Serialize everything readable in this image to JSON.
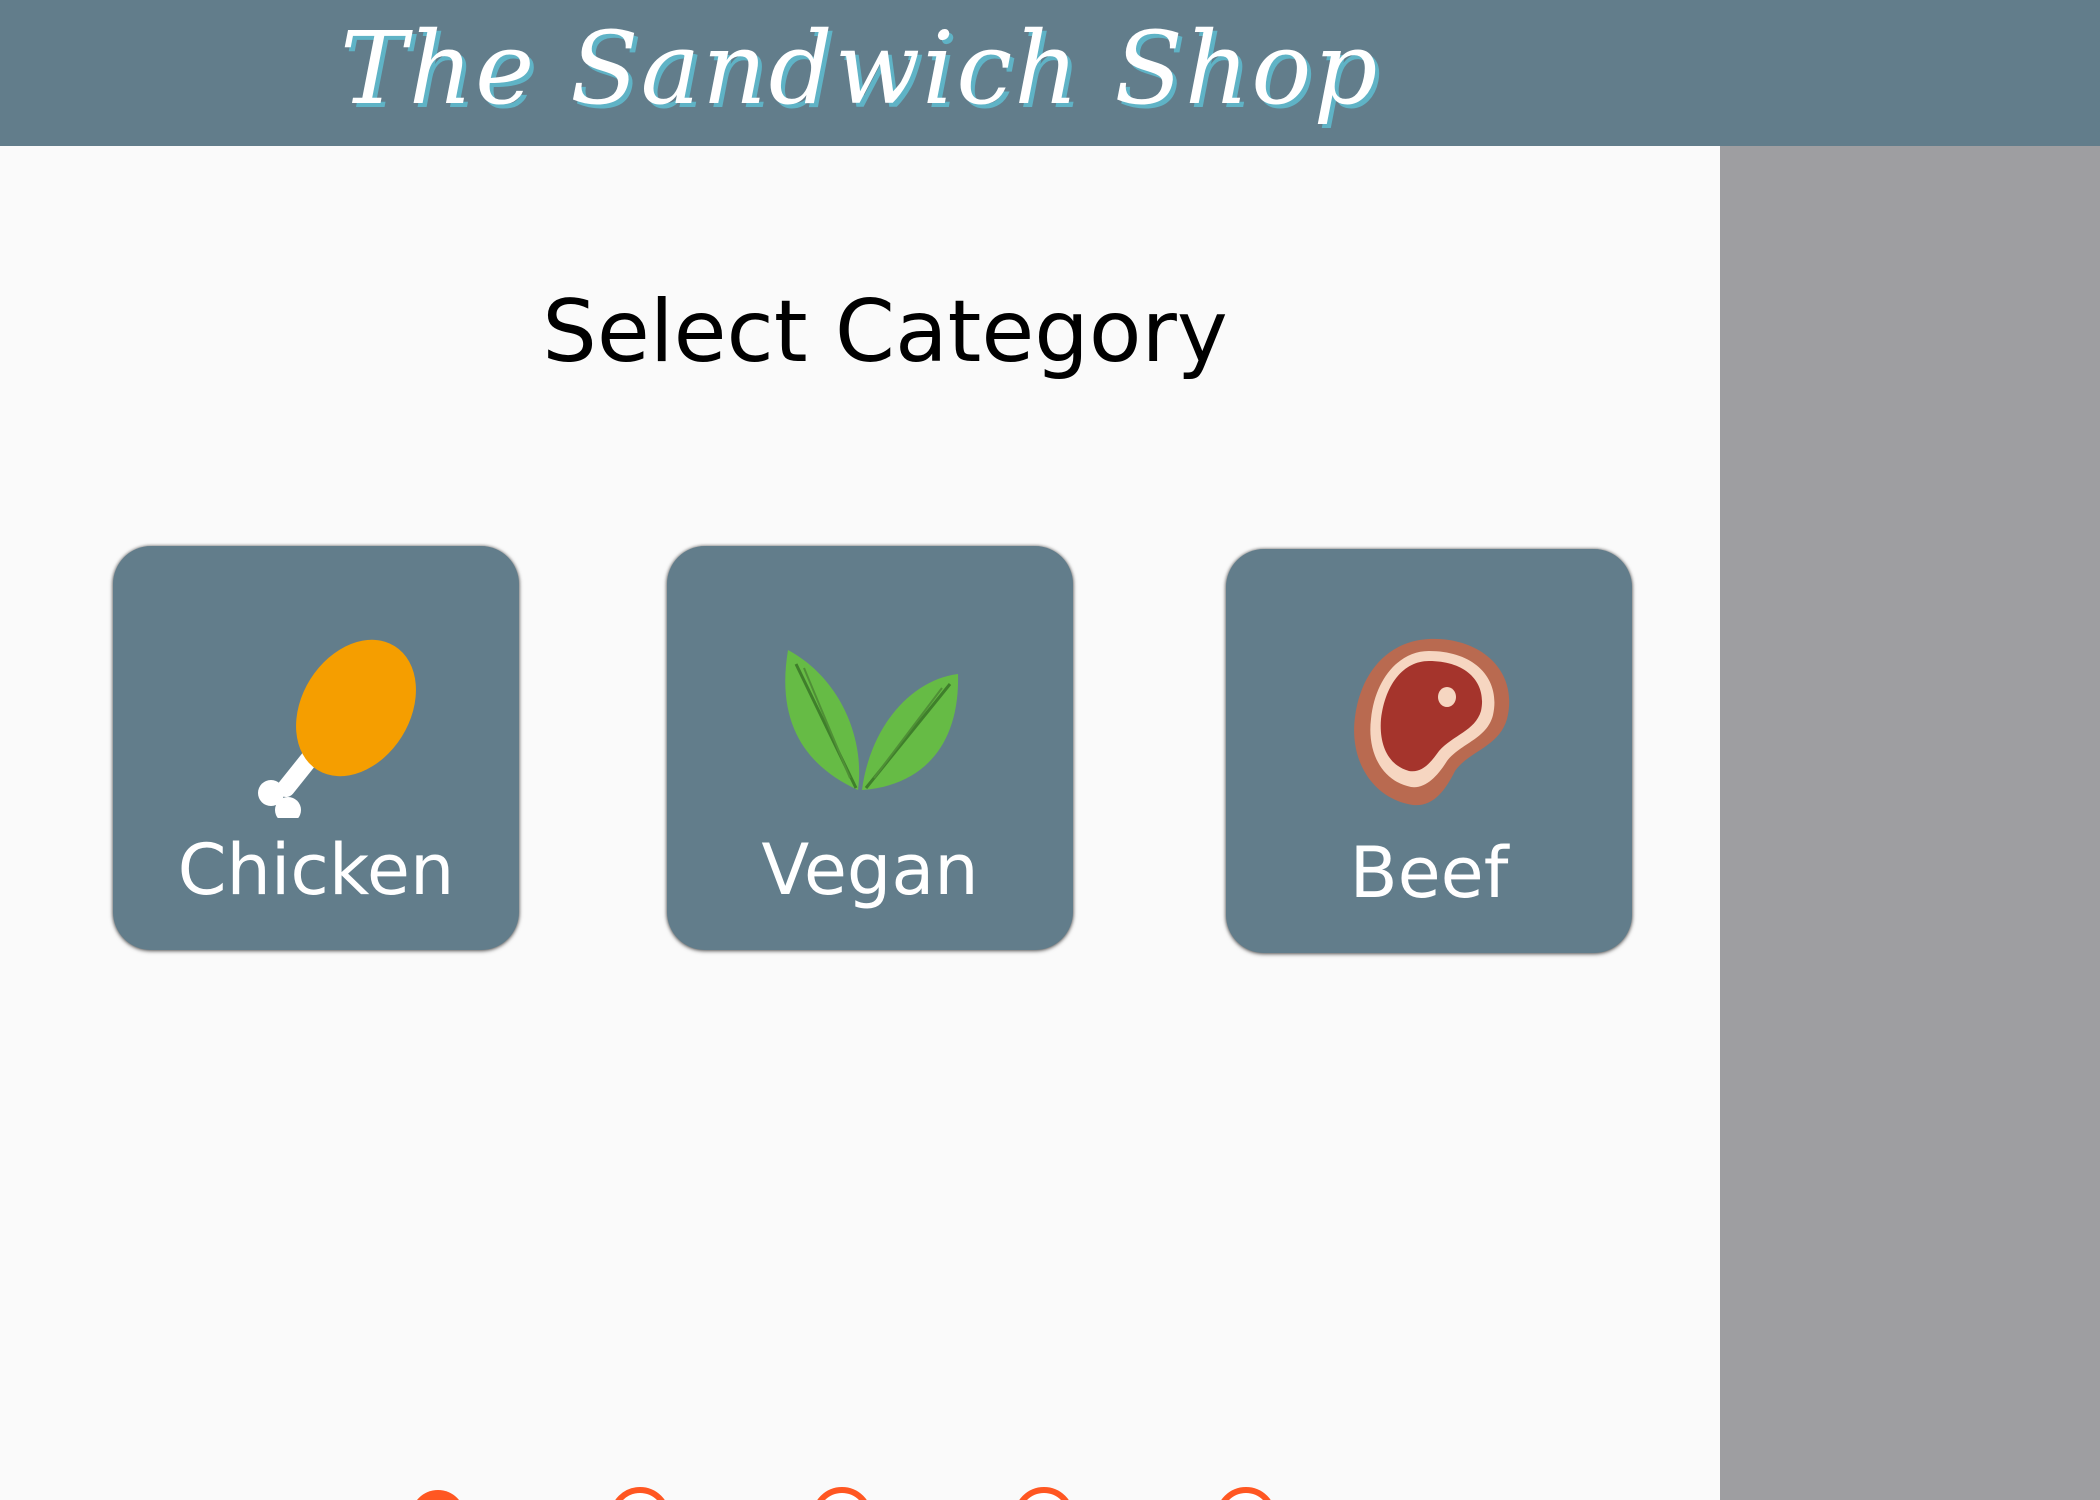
{
  "header": {
    "brand": "The Sandwich Shop"
  },
  "main": {
    "title": "Select Category",
    "categories": [
      {
        "label": "Chicken",
        "icon": "chicken-leg-icon"
      },
      {
        "label": "Vegan",
        "icon": "leaves-icon"
      },
      {
        "label": "Beef",
        "icon": "steak-icon"
      }
    ]
  },
  "stepper": {
    "total_steps": 5,
    "completed_steps": 1,
    "step_states": [
      "completed",
      "pending",
      "pending",
      "pending",
      "pending"
    ]
  },
  "colors": {
    "header_bg": "#627d8b",
    "card_bg": "#627d8b",
    "panel_bg": "#fafafa",
    "side_bg": "#9e9ea1",
    "brand_shadow": "#5fb3c6",
    "accent": "#ff5722",
    "chicken_orange": "#f59e00",
    "leaf_green": "#66bb45",
    "steak_red": "#a5342c",
    "steak_fat": "#f6d6c1",
    "steak_edge": "#b96a50"
  }
}
